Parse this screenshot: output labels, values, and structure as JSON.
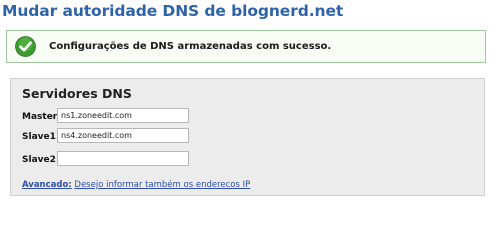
{
  "page": {
    "title": "Mudar autoridade DNS de blognerd.net"
  },
  "success": {
    "icon": "check-circle-icon",
    "message": "Configurações de DNS armazenadas com sucesso."
  },
  "dns_panel": {
    "title": "Servidores DNS",
    "rows": [
      {
        "label": "Master",
        "value": "ns1.zoneedit.com"
      },
      {
        "label": "Slave1",
        "value": "ns4.zoneedit.com"
      },
      {
        "label": "Slave2",
        "value": ""
      }
    ],
    "advanced_label": "Avancado:",
    "advanced_link": "Desejo informar também os enderecos IP"
  },
  "colors": {
    "title": "#2f63a8",
    "success_border": "#9ec79e",
    "success_icon": "#3d9a2f",
    "panel_bg": "#ececec",
    "link": "#2f4fa8"
  }
}
